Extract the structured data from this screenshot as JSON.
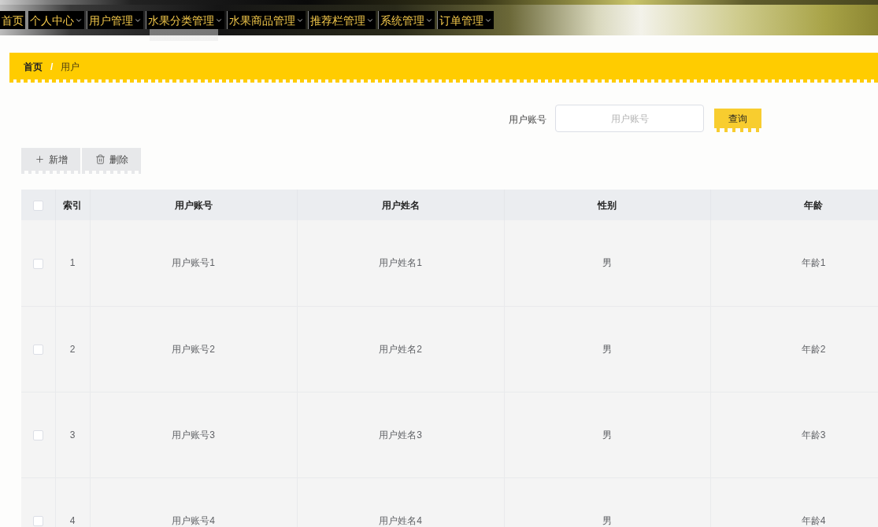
{
  "nav": {
    "items": [
      {
        "label": "首页",
        "dropdown": false,
        "expanded": false
      },
      {
        "label": "个人中心",
        "dropdown": true,
        "expanded": false
      },
      {
        "label": "用户管理",
        "dropdown": true,
        "expanded": false
      },
      {
        "label": "水果分类管理",
        "dropdown": true,
        "expanded": true
      },
      {
        "label": "水果商品管理",
        "dropdown": true,
        "expanded": false
      },
      {
        "label": "推荐栏管理",
        "dropdown": true,
        "expanded": false
      },
      {
        "label": "系统管理",
        "dropdown": true,
        "expanded": false
      },
      {
        "label": "订单管理",
        "dropdown": true,
        "expanded": false
      }
    ]
  },
  "breadcrumb": {
    "separator": "/",
    "items": [
      {
        "label": "首页",
        "current": false
      },
      {
        "label": "用户",
        "current": true
      }
    ]
  },
  "search": {
    "label": "用户账号",
    "placeholder": "用户账号",
    "button": "查询"
  },
  "toolbar": [
    {
      "kind": "add",
      "label": "新增"
    },
    {
      "kind": "delete",
      "label": "删除"
    }
  ],
  "table": {
    "select_all": {
      "checked": false
    },
    "columns": [
      "索引",
      "用户账号",
      "用户姓名",
      "性别",
      "年龄"
    ],
    "rows": [
      {
        "selected": false,
        "cells": [
          "1",
          "用户账号1",
          "用户姓名1",
          "男",
          "年龄1"
        ]
      },
      {
        "selected": false,
        "cells": [
          "2",
          "用户账号2",
          "用户姓名2",
          "男",
          "年龄2"
        ]
      },
      {
        "selected": false,
        "cells": [
          "3",
          "用户账号3",
          "用户姓名3",
          "男",
          "年龄3"
        ]
      },
      {
        "selected": false,
        "cells": [
          "4",
          "用户账号4",
          "用户姓名4",
          "男",
          "年龄4"
        ]
      }
    ]
  }
}
